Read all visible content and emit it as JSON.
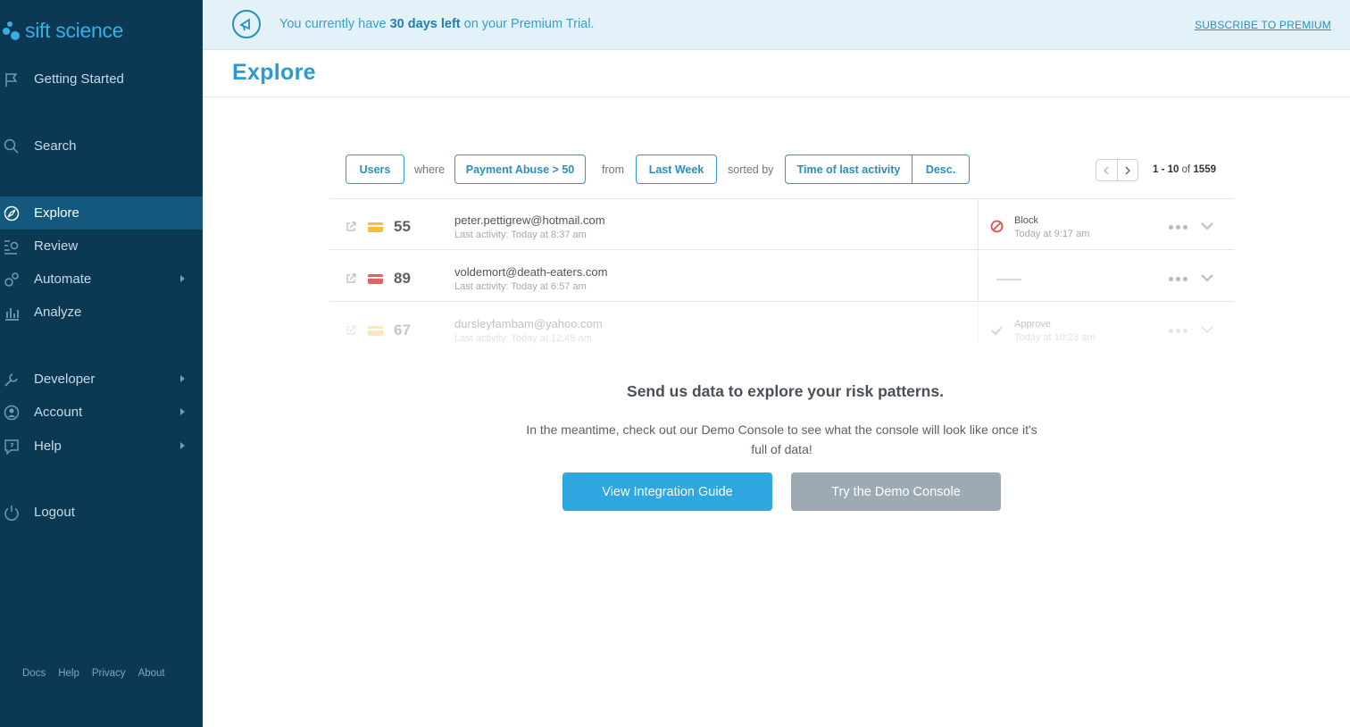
{
  "brand": {
    "name": "sift science"
  },
  "sidebar": {
    "items": [
      {
        "key": "getting-started",
        "label": "Getting Started"
      },
      {
        "key": "search",
        "label": "Search"
      },
      {
        "key": "explore",
        "label": "Explore"
      },
      {
        "key": "review",
        "label": "Review"
      },
      {
        "key": "automate",
        "label": "Automate"
      },
      {
        "key": "analyze",
        "label": "Analyze"
      },
      {
        "key": "developer",
        "label": "Developer"
      },
      {
        "key": "account",
        "label": "Account"
      },
      {
        "key": "help",
        "label": "Help"
      },
      {
        "key": "logout",
        "label": "Logout"
      }
    ],
    "active": "Explore",
    "footer_links": [
      "Docs",
      "Help",
      "Privacy",
      "About"
    ]
  },
  "banner": {
    "text_before": "You currently have ",
    "text_bold": "30 days left",
    "text_after": " on your Premium Trial.",
    "subscribe_label": "SUBSCRIBE TO PREMIUM"
  },
  "page": {
    "title": "Explore"
  },
  "filters": {
    "entity": "Users",
    "where_word": "where",
    "condition": "Payment Abuse > 50",
    "from_word": "from",
    "range": "Last Week",
    "sorted_word": "sorted by",
    "sort_field": "Time of last activity",
    "sort_order": "Desc."
  },
  "pagination": {
    "range": "1 - 10",
    "of_word": " of ",
    "total": "1559"
  },
  "rows": [
    {
      "score": "55",
      "email": "peter.pettigrew@hotmail.com",
      "activity": "Last activity: Today at 8:37 am",
      "decision": "Block",
      "decision_time": "Today at 9:17 am",
      "card_color": "#f5bf3c"
    },
    {
      "score": "89",
      "email": "voldemort@death-eaters.com",
      "activity": "Last activity: Today at 6:57 am",
      "decision": "",
      "decision_time": "",
      "card_color": "#e2625f"
    },
    {
      "score": "67",
      "email": "dursleyfambam@yahoo.com",
      "activity": "Last activity: Today at 12:45 am",
      "decision": "Approve",
      "decision_time": "Today at 10:23 am",
      "card_color": "#f5bf3c"
    }
  ],
  "empty_state": {
    "heading": "Send us data to explore your risk patterns.",
    "body": "In the meantime, check out our Demo Console to see what the console will look like once it's full of data!",
    "primary_button": "View Integration Guide",
    "secondary_button": "Try the Demo Console"
  },
  "colors": {
    "sidebar_bg": "#0b3954",
    "active_item_bg": "#14597d",
    "accent": "#2a9ad0",
    "banner_bg": "#e3f2f9",
    "block_red": "#d9534f",
    "approve_green": "#4caf50"
  }
}
